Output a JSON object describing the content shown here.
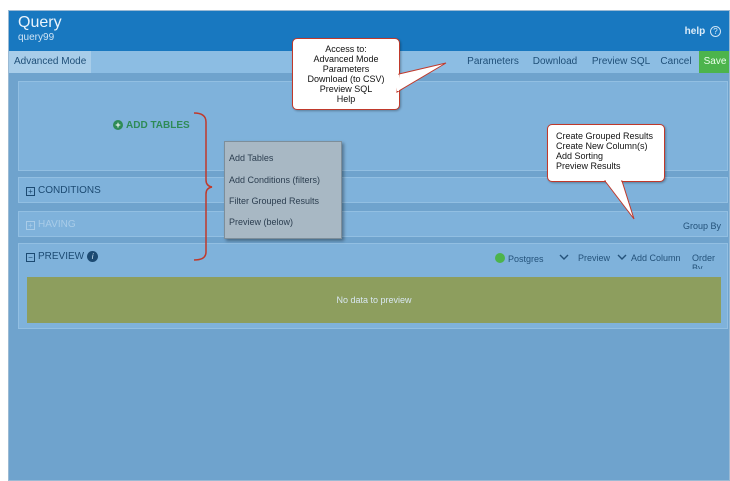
{
  "titlebar": {
    "app_title": "Query",
    "query_name": "query99",
    "help_label": "help",
    "help_icon": "?"
  },
  "toolbar": {
    "advanced_mode": "Advanced Mode",
    "parameters": "Parameters",
    "download": "Download",
    "preview_sql": "Preview SQL",
    "cancel": "Cancel",
    "save": "Save"
  },
  "tables": {
    "add_tables_label": "ADD TABLES"
  },
  "conditions": {
    "label": "CONDITIONS"
  },
  "having": {
    "label": "HAVING",
    "group_by": "Group By"
  },
  "preview": {
    "label": "PREVIEW",
    "db": "Postgres",
    "preview_label": "Preview",
    "add_column": "Add Column",
    "order_by": "Order By",
    "empty_message": "No data to preview"
  },
  "callout_top": {
    "lines": [
      "Access to:",
      "Advanced Mode",
      "Parameters",
      "Download (to CSV)",
      "Preview SQL",
      "Help"
    ]
  },
  "callout_right": {
    "lines": [
      "Create Grouped Results",
      "Create New Column(s)",
      "Add Sorting",
      "Preview Results"
    ]
  },
  "menu": {
    "items": [
      "Add Tables",
      "Add Conditions (filters)",
      "Filter Grouped Results",
      "Preview (below)"
    ]
  },
  "colors": {
    "titlebar": "#1878c0",
    "canvas": "#6fa3cd",
    "save": "#4cb44c",
    "preview_empty": "#8d9e5e",
    "callout_border": "#c0392b"
  }
}
